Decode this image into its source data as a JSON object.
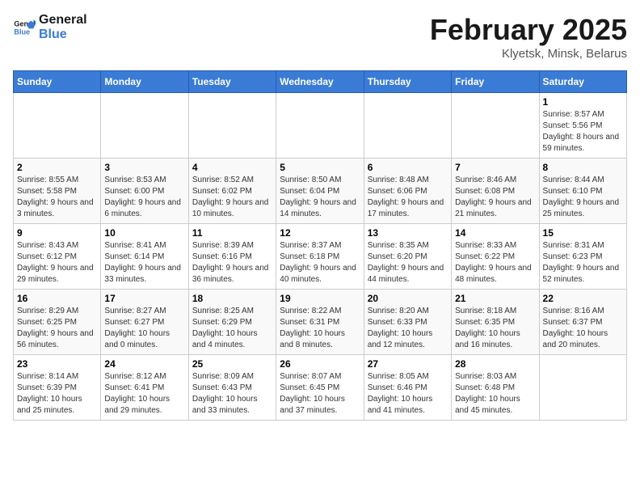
{
  "header": {
    "logo_line1": "General",
    "logo_line2": "Blue",
    "title": "February 2025",
    "subtitle": "Klyetsk, Minsk, Belarus"
  },
  "weekdays": [
    "Sunday",
    "Monday",
    "Tuesday",
    "Wednesday",
    "Thursday",
    "Friday",
    "Saturday"
  ],
  "weeks": [
    [
      {
        "day": "",
        "info": ""
      },
      {
        "day": "",
        "info": ""
      },
      {
        "day": "",
        "info": ""
      },
      {
        "day": "",
        "info": ""
      },
      {
        "day": "",
        "info": ""
      },
      {
        "day": "",
        "info": ""
      },
      {
        "day": "1",
        "info": "Sunrise: 8:57 AM\nSunset: 5:56 PM\nDaylight: 8 hours and 59 minutes."
      }
    ],
    [
      {
        "day": "2",
        "info": "Sunrise: 8:55 AM\nSunset: 5:58 PM\nDaylight: 9 hours and 3 minutes."
      },
      {
        "day": "3",
        "info": "Sunrise: 8:53 AM\nSunset: 6:00 PM\nDaylight: 9 hours and 6 minutes."
      },
      {
        "day": "4",
        "info": "Sunrise: 8:52 AM\nSunset: 6:02 PM\nDaylight: 9 hours and 10 minutes."
      },
      {
        "day": "5",
        "info": "Sunrise: 8:50 AM\nSunset: 6:04 PM\nDaylight: 9 hours and 14 minutes."
      },
      {
        "day": "6",
        "info": "Sunrise: 8:48 AM\nSunset: 6:06 PM\nDaylight: 9 hours and 17 minutes."
      },
      {
        "day": "7",
        "info": "Sunrise: 8:46 AM\nSunset: 6:08 PM\nDaylight: 9 hours and 21 minutes."
      },
      {
        "day": "8",
        "info": "Sunrise: 8:44 AM\nSunset: 6:10 PM\nDaylight: 9 hours and 25 minutes."
      }
    ],
    [
      {
        "day": "9",
        "info": "Sunrise: 8:43 AM\nSunset: 6:12 PM\nDaylight: 9 hours and 29 minutes."
      },
      {
        "day": "10",
        "info": "Sunrise: 8:41 AM\nSunset: 6:14 PM\nDaylight: 9 hours and 33 minutes."
      },
      {
        "day": "11",
        "info": "Sunrise: 8:39 AM\nSunset: 6:16 PM\nDaylight: 9 hours and 36 minutes."
      },
      {
        "day": "12",
        "info": "Sunrise: 8:37 AM\nSunset: 6:18 PM\nDaylight: 9 hours and 40 minutes."
      },
      {
        "day": "13",
        "info": "Sunrise: 8:35 AM\nSunset: 6:20 PM\nDaylight: 9 hours and 44 minutes."
      },
      {
        "day": "14",
        "info": "Sunrise: 8:33 AM\nSunset: 6:22 PM\nDaylight: 9 hours and 48 minutes."
      },
      {
        "day": "15",
        "info": "Sunrise: 8:31 AM\nSunset: 6:23 PM\nDaylight: 9 hours and 52 minutes."
      }
    ],
    [
      {
        "day": "16",
        "info": "Sunrise: 8:29 AM\nSunset: 6:25 PM\nDaylight: 9 hours and 56 minutes."
      },
      {
        "day": "17",
        "info": "Sunrise: 8:27 AM\nSunset: 6:27 PM\nDaylight: 10 hours and 0 minutes."
      },
      {
        "day": "18",
        "info": "Sunrise: 8:25 AM\nSunset: 6:29 PM\nDaylight: 10 hours and 4 minutes."
      },
      {
        "day": "19",
        "info": "Sunrise: 8:22 AM\nSunset: 6:31 PM\nDaylight: 10 hours and 8 minutes."
      },
      {
        "day": "20",
        "info": "Sunrise: 8:20 AM\nSunset: 6:33 PM\nDaylight: 10 hours and 12 minutes."
      },
      {
        "day": "21",
        "info": "Sunrise: 8:18 AM\nSunset: 6:35 PM\nDaylight: 10 hours and 16 minutes."
      },
      {
        "day": "22",
        "info": "Sunrise: 8:16 AM\nSunset: 6:37 PM\nDaylight: 10 hours and 20 minutes."
      }
    ],
    [
      {
        "day": "23",
        "info": "Sunrise: 8:14 AM\nSunset: 6:39 PM\nDaylight: 10 hours and 25 minutes."
      },
      {
        "day": "24",
        "info": "Sunrise: 8:12 AM\nSunset: 6:41 PM\nDaylight: 10 hours and 29 minutes."
      },
      {
        "day": "25",
        "info": "Sunrise: 8:09 AM\nSunset: 6:43 PM\nDaylight: 10 hours and 33 minutes."
      },
      {
        "day": "26",
        "info": "Sunrise: 8:07 AM\nSunset: 6:45 PM\nDaylight: 10 hours and 37 minutes."
      },
      {
        "day": "27",
        "info": "Sunrise: 8:05 AM\nSunset: 6:46 PM\nDaylight: 10 hours and 41 minutes."
      },
      {
        "day": "28",
        "info": "Sunrise: 8:03 AM\nSunset: 6:48 PM\nDaylight: 10 hours and 45 minutes."
      },
      {
        "day": "",
        "info": ""
      }
    ]
  ]
}
